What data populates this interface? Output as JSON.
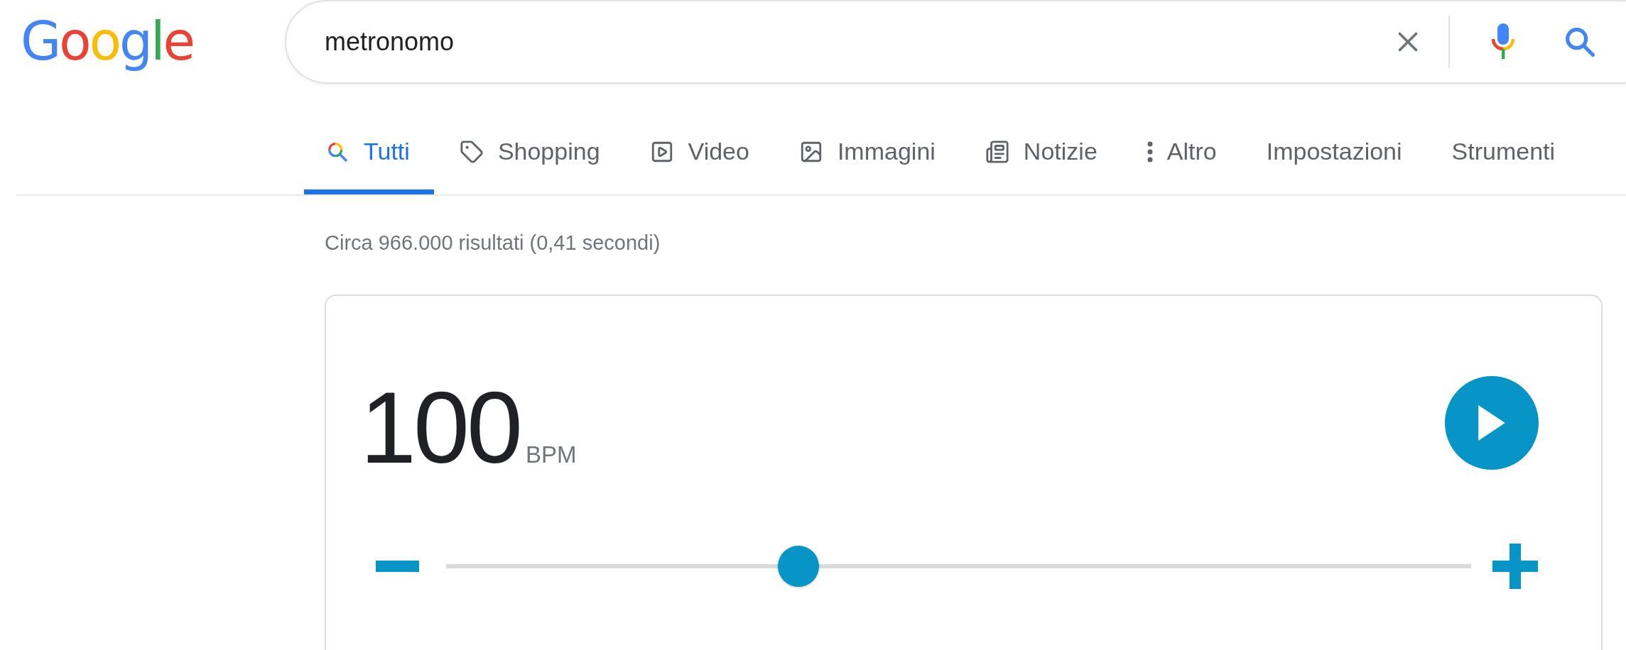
{
  "logo": "Google",
  "search": {
    "value": "metronomo"
  },
  "tabs": [
    {
      "label": "Tutti",
      "kind": "search",
      "selected": true
    },
    {
      "label": "Shopping",
      "kind": "tag",
      "selected": false
    },
    {
      "label": "Video",
      "kind": "play",
      "selected": false
    },
    {
      "label": "Immagini",
      "kind": "image",
      "selected": false
    },
    {
      "label": "Notizie",
      "kind": "news",
      "selected": false
    },
    {
      "label": "Altro",
      "kind": "more",
      "selected": false
    },
    {
      "label": "Impostazioni",
      "kind": "plain",
      "selected": false
    },
    {
      "label": "Strumenti",
      "kind": "plain",
      "selected": false
    }
  ],
  "result_stats": "Circa 966.000 risultati (0,41 secondi)",
  "metronome": {
    "tempo": "100",
    "unit": "BPM",
    "tempo_slider": {
      "level": 0.344
    }
  }
}
